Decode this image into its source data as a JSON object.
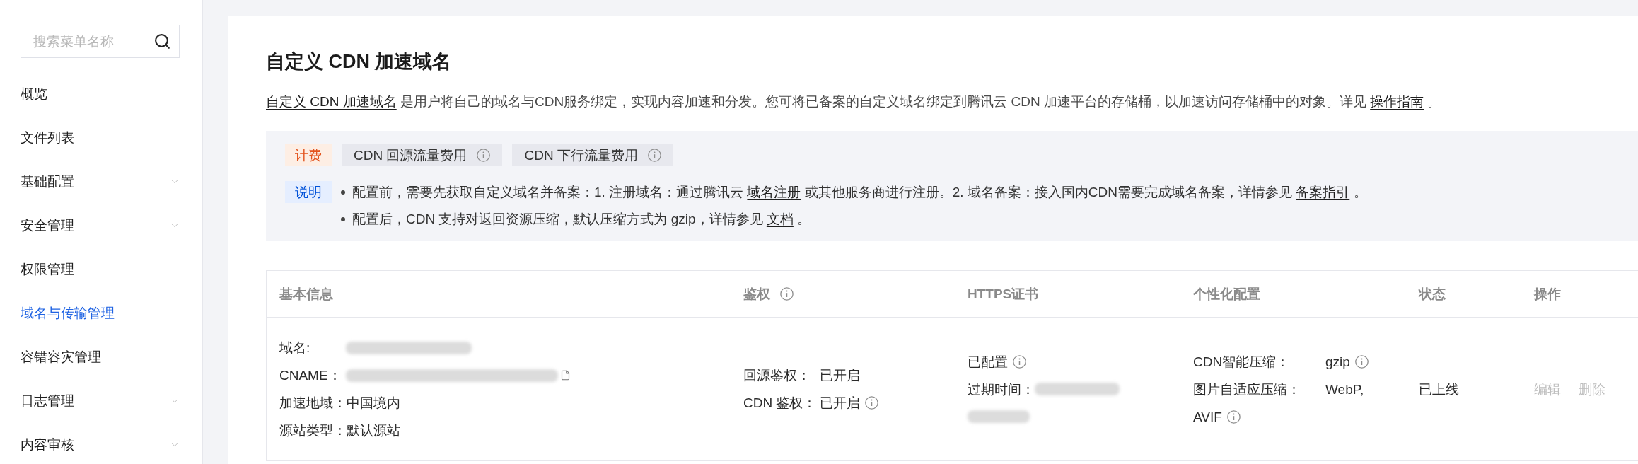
{
  "sidebar": {
    "search": {
      "placeholder": "搜索菜单名称"
    },
    "items": [
      {
        "label": "概览",
        "kind": "link",
        "selected": false
      },
      {
        "label": "文件列表",
        "kind": "link",
        "selected": false
      },
      {
        "label": "基础配置",
        "kind": "group",
        "selected": false
      },
      {
        "label": "安全管理",
        "kind": "group",
        "selected": false
      },
      {
        "label": "权限管理",
        "kind": "link",
        "selected": false
      },
      {
        "label": "域名与传输管理",
        "kind": "link",
        "selected": true
      },
      {
        "label": "容错容灾管理",
        "kind": "link",
        "selected": false
      },
      {
        "label": "日志管理",
        "kind": "group",
        "selected": false
      },
      {
        "label": "内容审核",
        "kind": "group",
        "selected": false
      }
    ]
  },
  "page": {
    "title": "自定义 CDN 加速域名",
    "description": [
      {
        "kind": "link",
        "text": "自定义 CDN 加速域名"
      },
      {
        "kind": "text",
        "text": " 是用户将自己的域名与CDN服务绑定，实现内容加速和分发。您可将已备案的自定义域名绑定到腾讯云 CDN 加速平台的存储桶，以加速访问存储桶中的对象。详见 "
      },
      {
        "kind": "link",
        "text": "操作指南"
      },
      {
        "kind": "text",
        "text": " 。"
      }
    ]
  },
  "notice": {
    "billing": {
      "tag": "计费",
      "items": [
        {
          "label": "CDN 回源流量费用",
          "info": true
        },
        {
          "label": "CDN 下行流量费用",
          "info": true
        }
      ]
    },
    "notes": {
      "tag": "说明",
      "bullets": [
        [
          {
            "kind": "text",
            "text": "配置前，需要先获取自定义域名并备案：1. 注册域名：通过腾讯云 "
          },
          {
            "kind": "link",
            "text": "域名注册"
          },
          {
            "kind": "text",
            "text": " 或其他服务商进行注册。2. 域名备案：接入国内CDN需要完成域名备案，详情参见 "
          },
          {
            "kind": "link",
            "text": "备案指引"
          },
          {
            "kind": "text",
            "text": " 。"
          }
        ],
        [
          {
            "kind": "text",
            "text": "配置后，CDN 支持对返回资源压缩，默认压缩方式为 gzip，详情参见 "
          },
          {
            "kind": "link",
            "text": "文档"
          },
          {
            "kind": "text",
            "text": " 。"
          }
        ]
      ]
    }
  },
  "table": {
    "columns": [
      {
        "label": "基本信息",
        "info": false
      },
      {
        "label": "鉴权",
        "info": true
      },
      {
        "label": "HTTPS证书",
        "info": false
      },
      {
        "label": "个性化配置",
        "info": false
      },
      {
        "label": "状态",
        "info": false
      },
      {
        "label": "操作",
        "info": false
      }
    ],
    "rows": [
      {
        "basic_info": [
          {
            "label": "域名:",
            "redacted": true,
            "copyable": false
          },
          {
            "label": "CNAME：",
            "redacted": true,
            "copyable": true
          },
          {
            "label": "加速地域：",
            "value": "中国境内",
            "redacted": false,
            "copyable": false
          },
          {
            "label": "源站类型：",
            "value": "默认源站",
            "redacted": false,
            "copyable": false
          }
        ],
        "auth": [
          {
            "label": "回源鉴权：",
            "value": "已开启",
            "info": false
          },
          {
            "label": "CDN 鉴权：",
            "value": "已开启",
            "info": true
          }
        ],
        "https": {
          "status": "已配置",
          "info": true,
          "expiry_label": "过期时间：",
          "expiry_redacted": true
        },
        "custom_config": [
          {
            "label": "CDN智能压缩：",
            "value_lines": [
              "gzip"
            ],
            "info": true
          },
          {
            "label": "图片自适应压缩：",
            "value_lines": [
              "WebP,",
              "AVIF"
            ],
            "info": true
          }
        ],
        "status": "已上线",
        "actions": [
          {
            "label": "编辑",
            "disabled": true
          },
          {
            "label": "删除",
            "disabled": true
          }
        ]
      }
    ]
  }
}
